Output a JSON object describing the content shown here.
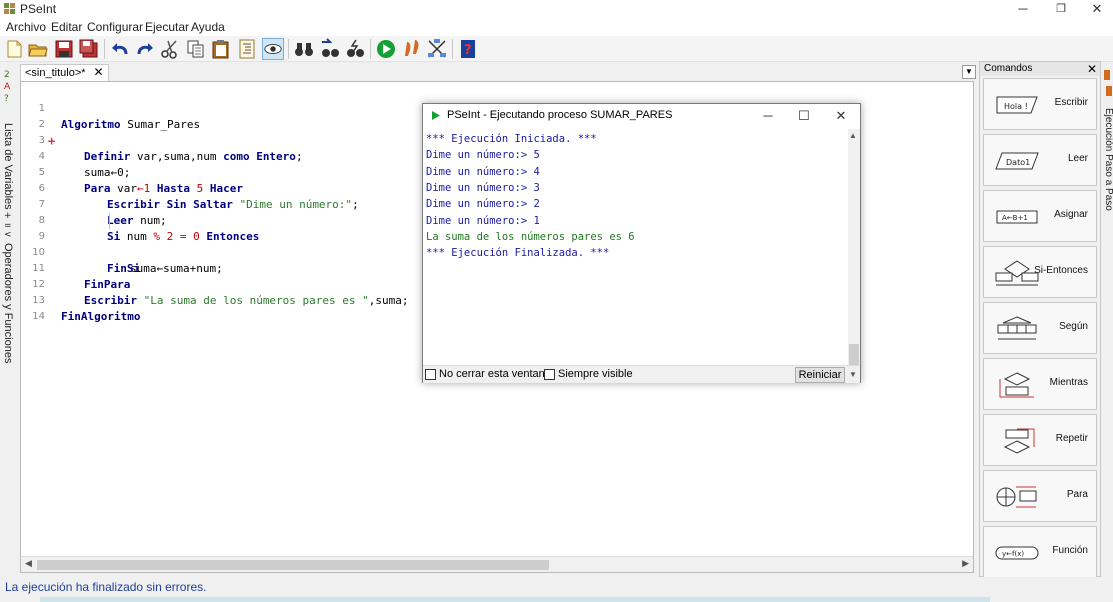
{
  "window": {
    "title": "PSeInt",
    "min": "─",
    "max": "❐",
    "close": "✕"
  },
  "menu": [
    "Archivo",
    "Editar",
    "Configurar",
    "Ejecutar",
    "Ayuda"
  ],
  "tabs": {
    "active_label": "<sin_titulo>*",
    "close": "✕",
    "dropdown": "▼"
  },
  "left_panel": {
    "variables_label": "Lista de Variables",
    "operators_label": "Operadores y Funciones"
  },
  "editor": {
    "lines": [
      {
        "n": "1",
        "fold": ""
      },
      {
        "n": "2",
        "fold": "+"
      },
      {
        "n": "3",
        "fold": ""
      },
      {
        "n": "4",
        "fold": ""
      },
      {
        "n": "5",
        "fold": ""
      },
      {
        "n": "6",
        "fold": ""
      },
      {
        "n": "7",
        "fold": ""
      },
      {
        "n": "8",
        "fold": ""
      },
      {
        "n": "9",
        "fold": ""
      },
      {
        "n": "10",
        "fold": ""
      },
      {
        "n": "11",
        "fold": ""
      },
      {
        "n": "12",
        "fold": ""
      },
      {
        "n": "13",
        "fold": ""
      },
      {
        "n": "14",
        "fold": ""
      }
    ],
    "code": {
      "l1_kw": "Algoritmo",
      "l1_name": " Sumar_Pares",
      "l3_kw": "Definir",
      "l3_vars": " var,suma,num ",
      "l3_kw2": "como Entero",
      "l3_end": ";",
      "l4": "suma←0;",
      "l5_kw": "Para",
      "l5_var": " var",
      "l5_arrow": "←",
      "l5_one": "1",
      "l5_kw2": " Hasta ",
      "l5_five": "5",
      "l5_kw3": " Hacer",
      "l6_kw": "Escribir Sin Saltar",
      "l6_str": " \"Dime un número:\"",
      "l6_end": ";",
      "l7_kw": "Leer",
      "l7_rest": " num;",
      "l8_kw": "Si",
      "l8_a": " num ",
      "l8_mod": "%",
      "l8_two": " 2 ",
      "l8_eq": "=",
      "l8_zero": " 0 ",
      "l8_kw2": "Entonces",
      "l9": "suma←suma+num;",
      "l10_kw": "FinSi",
      "l11_kw": "FinPara",
      "l12_kw": "Escribir",
      "l12_str": " \"La suma de los números pares es \"",
      "l12_end": ",suma;",
      "l13_kw": "FinAlgoritmo"
    }
  },
  "commands_panel": {
    "header": "Comandos",
    "close": "✕",
    "items": [
      "Escribir",
      "Leer",
      "Asignar",
      "Si-Entonces",
      "Según",
      "Mientras",
      "Repetir",
      "Para",
      "Función"
    ],
    "icon_texts": {
      "escribir": "Hola !",
      "leer": "Dato1",
      "asignar": "A←B+1",
      "funcion": "y←f(x)"
    }
  },
  "right_vertical_label": "Ejecución Paso a Paso",
  "dialog": {
    "title": "PSeInt - Ejecutando proceso SUMAR_PARES",
    "min": "─",
    "max": "☐",
    "close": "✕",
    "console": [
      {
        "text": "*** Ejecución Iniciada. ***",
        "style": "c-blue"
      },
      {
        "text": "Dime un número:> 5",
        "style": "c-blue"
      },
      {
        "text": "Dime un número:> 4",
        "style": "c-blue"
      },
      {
        "text": "Dime un número:> 3",
        "style": "c-blue"
      },
      {
        "text": "Dime un número:> 2",
        "style": "c-blue"
      },
      {
        "text": "Dime un número:> 1",
        "style": "c-blue"
      },
      {
        "text": "La suma de los números pares es 6",
        "style": "c-green"
      },
      {
        "text": "*** Ejecución Finalizada. ***",
        "style": "c-blue"
      }
    ],
    "no_cerrar": "No cerrar esta ventana",
    "siempre_visible": "Siempre visible",
    "reiniciar": "Reiniciar"
  },
  "status": "La ejecución ha finalizado sin errores.",
  "colors": {
    "keyword": "#000080",
    "string": "#2c7a2c",
    "number": "#c00000",
    "status": "#1f3f9f"
  }
}
